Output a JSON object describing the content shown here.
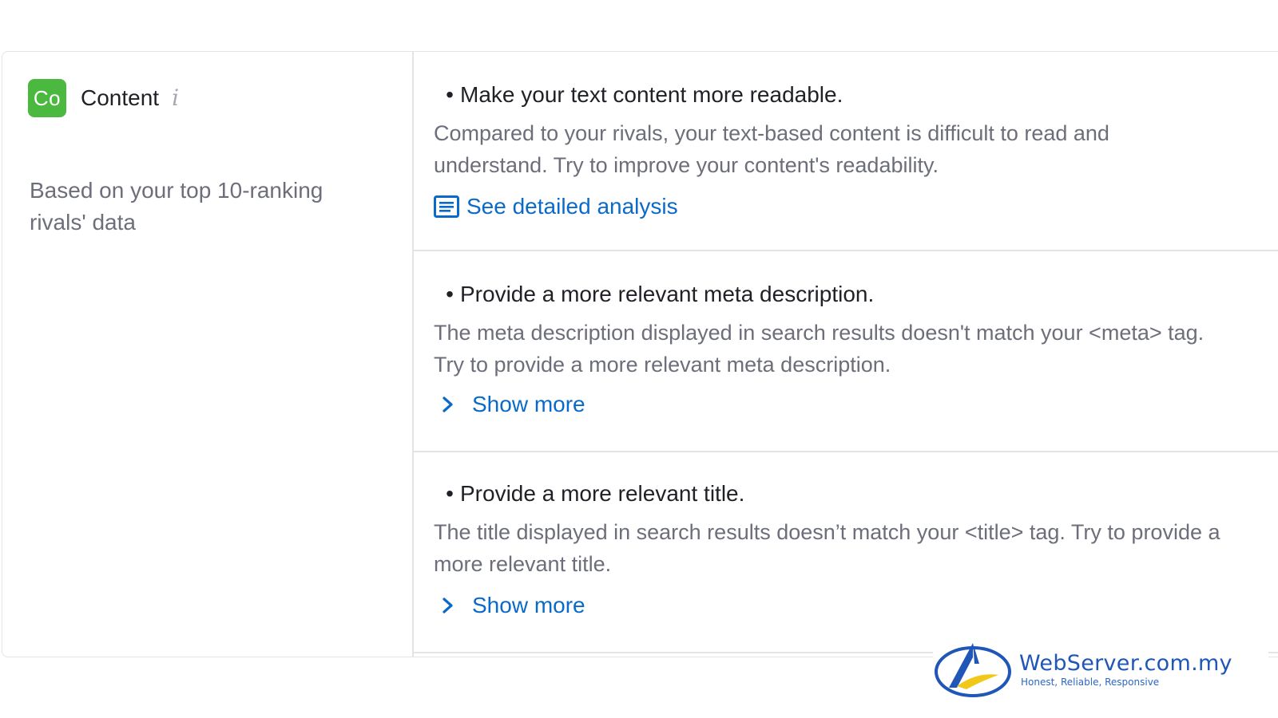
{
  "category": {
    "badge": "Co",
    "title": "Content",
    "info_icon": "info-icon",
    "subtitle": "Based on your top 10-ranking rivals' data",
    "badge_color": "#4bb93f"
  },
  "issues": [
    {
      "title": "Make your text content more readable.",
      "description": "Compared to your rivals, your text-based content is difficult to read and understand. Try to improve your content's readability.",
      "link_label": "See detailed analysis",
      "link_icon": "document-icon"
    },
    {
      "title": "Provide a more relevant meta description.",
      "description": "The meta description displayed in search results doesn't match your <meta> tag. Try to provide a more relevant meta description.",
      "link_label": "Show more",
      "link_icon": "chevron-right-icon"
    },
    {
      "title": "Provide a more relevant title.",
      "description": "The title displayed in search results doesn’t match your <title> tag. Try to provide a more relevant title.",
      "link_label": "Show more",
      "link_icon": "chevron-right-icon"
    }
  ],
  "bullet": "•",
  "link_color": "#0a6ac9",
  "watermark": {
    "name": "WebServer.com.my",
    "tagline": "Honest, Reliable, Responsive"
  }
}
